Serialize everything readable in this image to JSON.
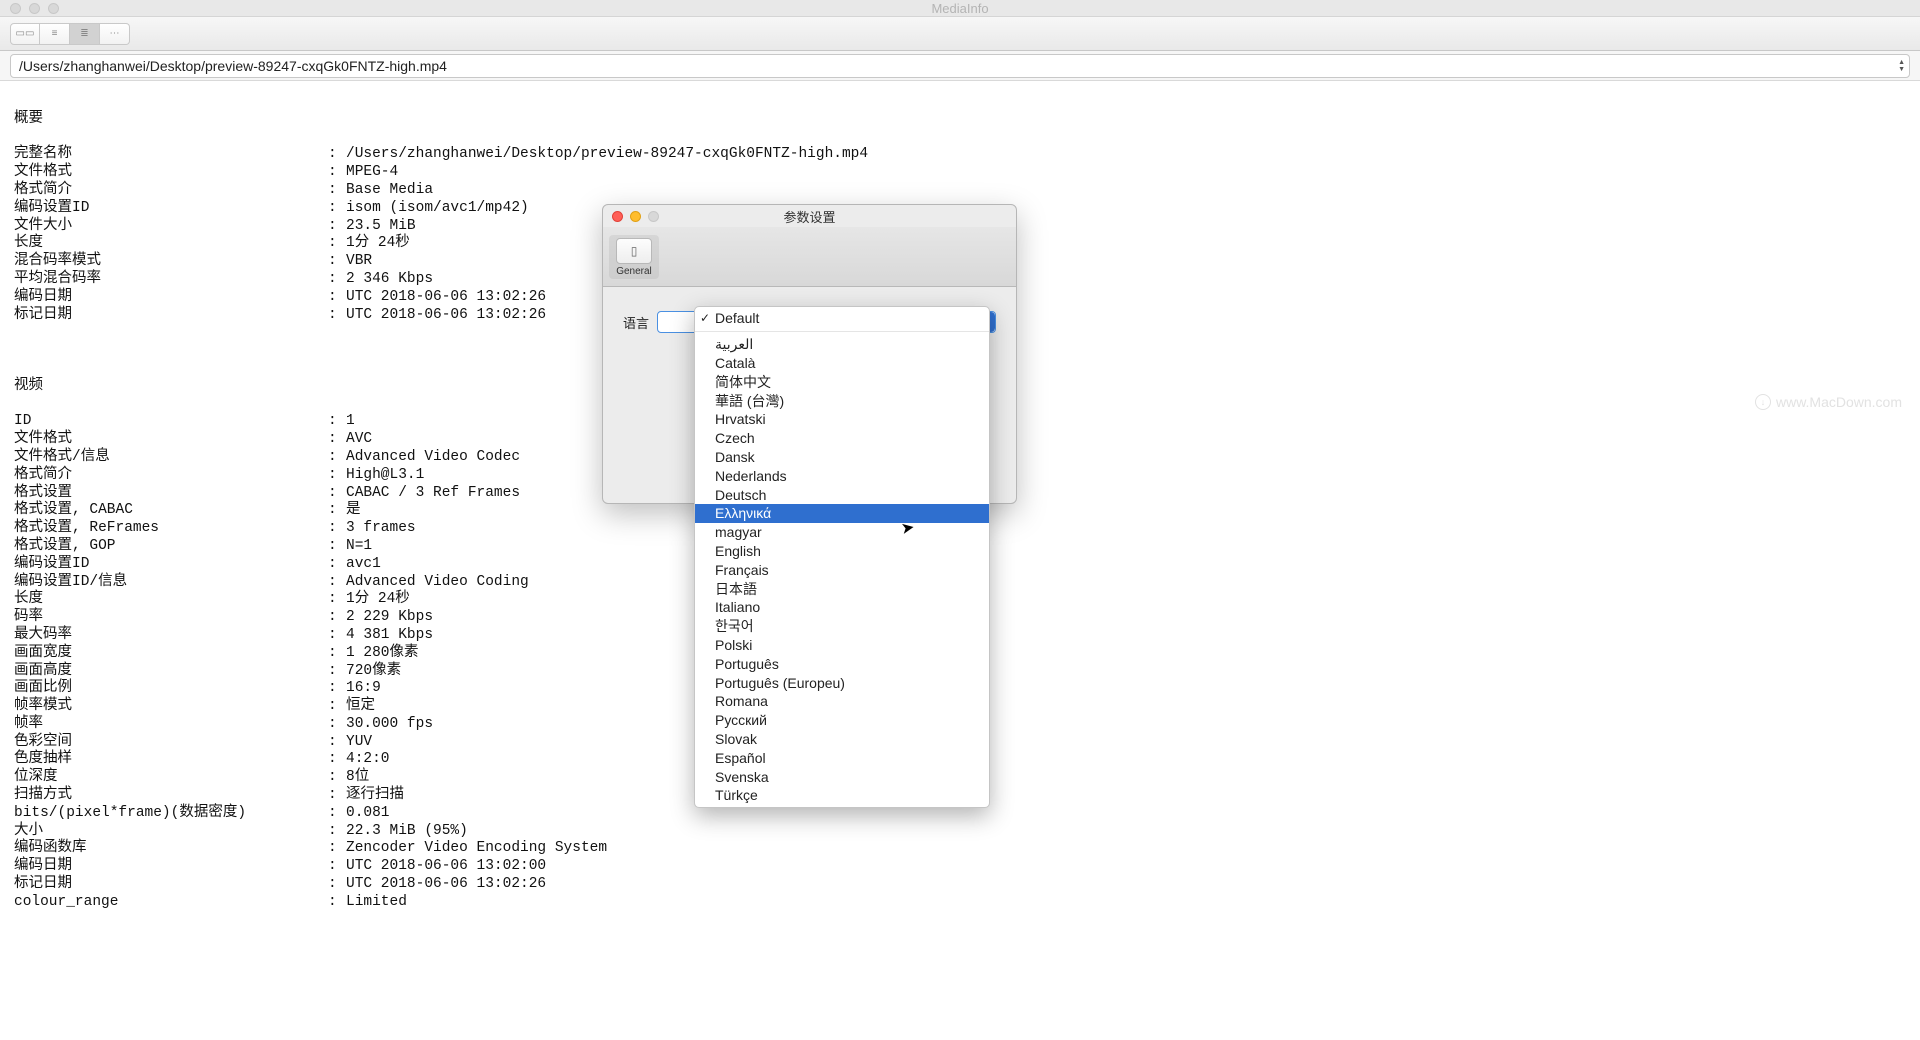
{
  "window": {
    "title": "MediaInfo",
    "path": "/Users/zhanghanwei/Desktop/preview-89247-cxqGk0FNTZ-high.mp4"
  },
  "sections": {
    "general": {
      "header": "概要",
      "rows": [
        {
          "label": "完整名称",
          "val": "/Users/zhanghanwei/Desktop/preview-89247-cxqGk0FNTZ-high.mp4"
        },
        {
          "label": "文件格式",
          "val": "MPEG-4"
        },
        {
          "label": "格式简介",
          "val": "Base Media"
        },
        {
          "label": "编码设置ID",
          "val": "isom (isom/avc1/mp42)"
        },
        {
          "label": "文件大小",
          "val": "23.5 MiB"
        },
        {
          "label": "长度",
          "val": "1分 24秒"
        },
        {
          "label": "混合码率模式",
          "val": "VBR"
        },
        {
          "label": "平均混合码率",
          "val": "2 346 Kbps"
        },
        {
          "label": "编码日期",
          "val": "UTC 2018-06-06 13:02:26"
        },
        {
          "label": "标记日期",
          "val": "UTC 2018-06-06 13:02:26"
        }
      ]
    },
    "video": {
      "header": "视频",
      "rows": [
        {
          "label": "ID",
          "val": "1"
        },
        {
          "label": "文件格式",
          "val": "AVC"
        },
        {
          "label": "文件格式/信息",
          "val": "Advanced Video Codec"
        },
        {
          "label": "格式简介",
          "val": "High@L3.1"
        },
        {
          "label": "格式设置",
          "val": "CABAC / 3 Ref Frames"
        },
        {
          "label": "格式设置, CABAC",
          "val": "是"
        },
        {
          "label": "格式设置, ReFrames",
          "val": "3 frames"
        },
        {
          "label": "格式设置, GOP",
          "val": "N=1"
        },
        {
          "label": "编码设置ID",
          "val": "avc1"
        },
        {
          "label": "编码设置ID/信息",
          "val": "Advanced Video Coding"
        },
        {
          "label": "长度",
          "val": "1分 24秒"
        },
        {
          "label": "码率",
          "val": "2 229 Kbps"
        },
        {
          "label": "最大码率",
          "val": "4 381 Kbps"
        },
        {
          "label": "画面宽度",
          "val": "1 280像素"
        },
        {
          "label": "画面高度",
          "val": "720像素"
        },
        {
          "label": "画面比例",
          "val": "16:9"
        },
        {
          "label": "帧率模式",
          "val": "恒定"
        },
        {
          "label": "帧率",
          "val": "30.000 fps"
        },
        {
          "label": "色彩空间",
          "val": "YUV"
        },
        {
          "label": "色度抽样",
          "val": "4:2:0"
        },
        {
          "label": "位深度",
          "val": "8位"
        },
        {
          "label": "扫描方式",
          "val": "逐行扫描"
        },
        {
          "label": "bits/(pixel*frame)(数据密度)",
          "val": "0.081"
        },
        {
          "label": "大小",
          "val": "22.3 MiB (95%)"
        },
        {
          "label": "编码函数库",
          "val": "Zencoder Video Encoding System"
        },
        {
          "label": "编码日期",
          "val": "UTC 2018-06-06 13:02:00"
        },
        {
          "label": "标记日期",
          "val": "UTC 2018-06-06 13:02:26"
        },
        {
          "label": "colour_range",
          "val": "Limited"
        }
      ]
    }
  },
  "prefs": {
    "title": "参数设置",
    "tab": "General",
    "language_label": "语言"
  },
  "dropdown": {
    "selected": "Default",
    "highlighted_index": 10,
    "items": [
      "Default",
      "العربية",
      "Català",
      "简体中文",
      "華語 (台灣)",
      "Hrvatski",
      "Czech",
      "Dansk",
      "Nederlands",
      "Deutsch",
      "Ελληνικά",
      "magyar",
      "English",
      "Français",
      "日本語",
      "Italiano",
      "한국어",
      "Polski",
      "Português",
      "Português (Europeu)",
      "Romana",
      "Русский",
      "Slovak",
      "Español",
      "Svenska",
      "Türkçe"
    ]
  },
  "watermark": "www.MacDown.com"
}
